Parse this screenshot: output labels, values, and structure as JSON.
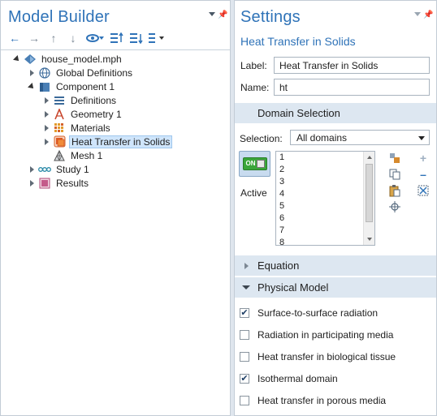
{
  "model_builder": {
    "title": "Model Builder",
    "tree": [
      {
        "label": "house_model.mph",
        "icon": "model-file-icon",
        "depth": 0,
        "state": "open"
      },
      {
        "label": "Global Definitions",
        "icon": "globe-icon",
        "depth": 1,
        "state": "closed"
      },
      {
        "label": "Component 1",
        "icon": "component-icon",
        "depth": 1,
        "state": "open"
      },
      {
        "label": "Definitions",
        "icon": "definitions-icon",
        "depth": 2,
        "state": "closed"
      },
      {
        "label": "Geometry 1",
        "icon": "geometry-icon",
        "depth": 2,
        "state": "closed"
      },
      {
        "label": "Materials",
        "icon": "materials-icon",
        "depth": 2,
        "state": "closed"
      },
      {
        "label": "Heat Transfer in Solids",
        "icon": "heat-transfer-icon",
        "depth": 2,
        "state": "closed",
        "selected": true
      },
      {
        "label": "Mesh 1",
        "icon": "mesh-icon",
        "depth": 2,
        "state": "none"
      },
      {
        "label": "Study 1",
        "icon": "study-icon",
        "depth": 1,
        "state": "closed"
      },
      {
        "label": "Results",
        "icon": "results-icon",
        "depth": 1,
        "state": "closed"
      }
    ]
  },
  "settings": {
    "title": "Settings",
    "subtitle": "Heat Transfer in Solids",
    "label_field": {
      "label": "Label:",
      "value": "Heat Transfer in Solids"
    },
    "name_field": {
      "label": "Name:",
      "value": "ht"
    },
    "domain_selection": {
      "header": "Domain Selection",
      "selection_label": "Selection:",
      "selection_value": "All domains",
      "active_label": "Active",
      "toggle_text": "ON",
      "domains": [
        "1",
        "2",
        "3",
        "4",
        "5",
        "6",
        "7",
        "8"
      ]
    },
    "equation_header": "Equation",
    "physical_model": {
      "header": "Physical Model",
      "options": [
        {
          "label": "Surface-to-surface radiation",
          "checked": true
        },
        {
          "label": "Radiation in participating media",
          "checked": false
        },
        {
          "label": "Heat transfer in biological tissue",
          "checked": false
        },
        {
          "label": "Isothermal domain",
          "checked": true
        },
        {
          "label": "Heat transfer in porous media",
          "checked": false
        }
      ]
    }
  },
  "colors": {
    "accent": "#2f73b8",
    "section_bg": "#dde7f1",
    "selected_bg": "#cfe5fb",
    "toggle_green": "#3aa63a"
  }
}
